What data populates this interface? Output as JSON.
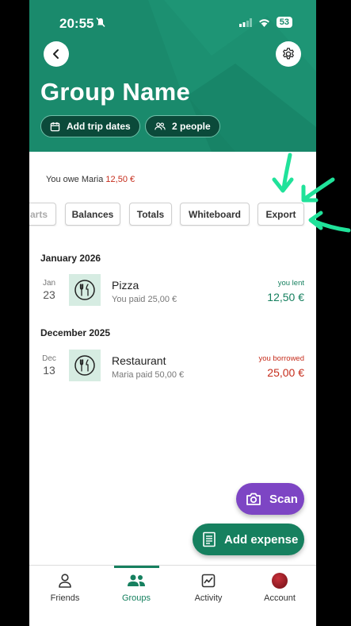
{
  "status_bar": {
    "time": "20:55",
    "battery": "53"
  },
  "header": {
    "title": "Group Name",
    "chips": {
      "dates": "Add trip dates",
      "people": "2 people"
    }
  },
  "balance_line": {
    "text": "You owe Maria",
    "amount": "12,50 €"
  },
  "tabs": {
    "charts": "arts",
    "balances": "Balances",
    "totals": "Totals",
    "whiteboard": "Whiteboard",
    "export": "Export"
  },
  "sections": [
    {
      "month": "January 2026",
      "expenses": [
        {
          "month_abbr": "Jan",
          "day": "23",
          "title": "Pizza",
          "subtitle": "You paid 25,00 €",
          "status": "you lent",
          "amount": "12,50 €"
        }
      ]
    },
    {
      "month": "December 2025",
      "expenses": [
        {
          "month_abbr": "Dec",
          "day": "13",
          "title": "Restaurant",
          "subtitle": "Maria paid 50,00 €",
          "status": "you borrowed",
          "amount": "25,00 €"
        }
      ]
    }
  ],
  "fabs": {
    "scan": "Scan",
    "add_expense": "Add expense"
  },
  "nav": {
    "friends": "Friends",
    "groups": "Groups",
    "activity": "Activity",
    "account": "Account"
  },
  "colors": {
    "brand_green": "#1a8a6c",
    "accent_green": "#16805f",
    "debt_red": "#c62d1c",
    "scan_purple": "#7d45c4",
    "annotation_green": "#20e29a"
  }
}
